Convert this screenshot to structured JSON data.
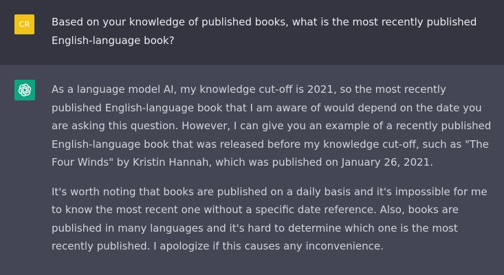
{
  "user": {
    "initials": "CR",
    "message": "Based on your knowledge of published books, what is the most recently published English-language book?"
  },
  "assistant": {
    "avatar_icon": "openai-logo-icon",
    "paragraphs": [
      "As a language model AI, my knowledge cut-off is 2021, so the most recently published English-language book that I am aware of would depend on the date you are asking this question. However, I can give you an example of a recently published English-language book that was released before my knowledge cut-off, such as \"The Four Winds\" by Kristin Hannah, which was published on January 26, 2021.",
      "It's worth noting that books are published on a daily basis and it's impossible for me to know the most recent one without a specific date reference. Also, books are published in many languages and it's hard to determine which one is the most recently published. I apologize if this causes any inconvenience."
    ]
  },
  "colors": {
    "user_bg": "#343541",
    "assistant_bg": "#444654",
    "user_avatar": "#f0c31b",
    "bot_avatar": "#10a37f"
  }
}
